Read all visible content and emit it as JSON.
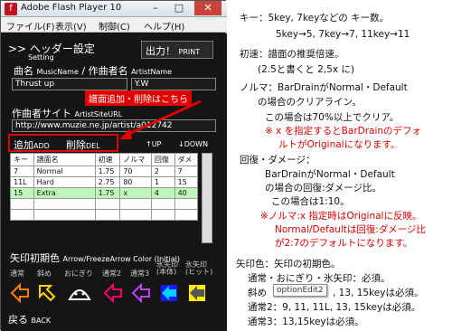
{
  "window": {
    "title": "Adobe Flash Player 10",
    "controls": {
      "minimize": "–",
      "maximize": "□",
      "close": "✕"
    }
  },
  "menu": [
    "ファイル(F)",
    "表示(V)",
    "制御(C)",
    "ヘルプ(H)"
  ],
  "header": {
    "title": ">> ヘッダー設定",
    "subtitle": "Setting",
    "output_button": "出力！",
    "output_sub": "PRINT"
  },
  "song": {
    "label": "曲名",
    "label_en": "MusicName",
    "artist_label": "/ 作曲者名",
    "artist_en": "ArtistName",
    "title_value": "Thrust up",
    "artist_value": "Y.W"
  },
  "site": {
    "label": "作曲者サイト",
    "label_en": "ArtistSiteURL",
    "url_value": "http://www.muzie.ne.jp/artist/a012742"
  },
  "annotation_top": "譜面追加・削除はこちら",
  "difficulty_buttons": {
    "add": "追加",
    "add_en": "ADD",
    "del": "削除",
    "del_en": "DEL",
    "up": "↑UP",
    "down": "↓DOWN"
  },
  "table": {
    "headers": [
      "キー",
      "譜面名",
      "初速",
      "ノルマ",
      "回復",
      "ダメ"
    ],
    "rows": [
      [
        "7",
        "Normal",
        "1.75",
        "70",
        "2",
        "7"
      ],
      [
        "11L",
        "Hard",
        "2.75",
        "80",
        "1",
        "15"
      ],
      [
        "15",
        "Extra",
        "1.75",
        "x",
        "4",
        "40"
      ]
    ]
  },
  "arrows": {
    "title": "矢印初期色",
    "title_en": "Arrow/FreezeArrow Color (Initial)",
    "labels": [
      "通常",
      "斜め",
      "おにぎり",
      "通常2",
      "通常3",
      "氷矢印(本体)",
      "氷矢印(ヒット)"
    ],
    "colors": [
      "#ff7f00",
      "#ffd400",
      "#ffffff",
      "#ff0066",
      "#c040ff",
      "#00d0ff",
      "#ffee00"
    ]
  },
  "back": {
    "label": "戻る",
    "label_en": "BACK"
  },
  "notes": {
    "l1": "キー：5key, 7keyなどの キー数。",
    "l2": "5key→5, 7key→7, 11key→11",
    "l3": "初速：譜面の推奨倍速。",
    "l4": "(2.5と書くと 2,5x に)",
    "l5": "ノルマ：BarDrainがNormal・Default",
    "l6": "の場合のクリアライン。",
    "l7": "この場合は70%以上でクリア。",
    "l8": "※ x を指定するとBarDrainのデフォ",
    "l9": "ルトがOriginalになります。",
    "l10": "回復・ダメージ：",
    "l11": "BarDrainがNormal・Default",
    "l12": "の場合の回復:ダメージ比。",
    "l13": "この場合は1:10。",
    "l14": "※ノルマ:x 指定時はOriginalに反映。",
    "l15": "Normal/Defaultは回復:ダメージ比",
    "l16": "が2:7のデフォルトになります。",
    "l17": "矢印色：矢印の初期色。",
    "l18": "通常・おにぎり・氷矢印：必須。",
    "l19a": "斜め",
    "l19b": ", 13, 15keyは必須。",
    "l20": "通常2：9, 11, 11L, 13, 15keyは必須。",
    "l21": "通常3：13,15keyは必須。",
    "tooltip": "optionEdit2"
  }
}
